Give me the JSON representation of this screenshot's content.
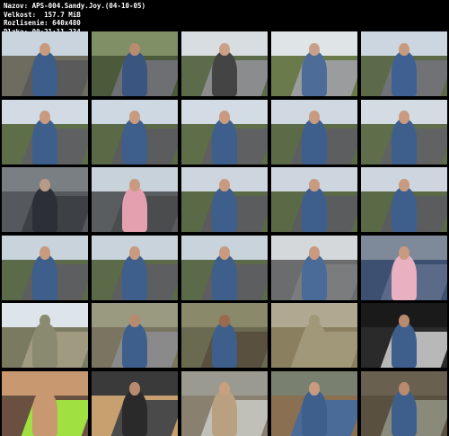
{
  "header": {
    "line1": "Nazov: APS-004.Sandy.Joy.(04-10-05)",
    "line2": "Velkost:  157.7 MiB",
    "line3": "Rozlisenie: 640x480",
    "line4": "Dlzka: 00:21:11.234"
  },
  "thumbnails": [
    {
      "sky": "#c9d4df",
      "ground": "#6e6b5f",
      "road": "#5a5a5a",
      "person": "#3d5d8a",
      "head": "#c89a80"
    },
    {
      "sky": "#7f9067",
      "ground": "#4a5a3a",
      "road": "#6d6f72",
      "person": "#3a5580",
      "head": "#b88a70"
    },
    {
      "sky": "#d8dde2",
      "ground": "#5c6b4a",
      "road": "#8a8c8e",
      "person": "#444",
      "head": "#caa088"
    },
    {
      "sky": "#dfe4e7",
      "ground": "#6a7a4a",
      "road": "#9a9c9e",
      "person": "#4d6c98",
      "head": "#c8a088"
    },
    {
      "sky": "#cbd6e0",
      "ground": "#5c6a4a",
      "road": "#707276",
      "person": "#3e6092",
      "head": "#c89a80"
    },
    {
      "sky": "#d2dbe3",
      "ground": "#5d6e48",
      "road": "#5e6062",
      "person": "#3e5f8c",
      "head": "#c89a80"
    },
    {
      "sky": "#cdd8e3",
      "ground": "#5a6a46",
      "road": "#5a5c5e",
      "person": "#3e5f8c",
      "head": "#c89a80"
    },
    {
      "sky": "#d3dce4",
      "ground": "#5d6e48",
      "road": "#5e6062",
      "person": "#3e5f8c",
      "head": "#c89a80"
    },
    {
      "sky": "#d0d9e2",
      "ground": "#5b6b47",
      "road": "#5c5e60",
      "person": "#3e5f8c",
      "head": "#c89a80"
    },
    {
      "sky": "#d4dce3",
      "ground": "#5e6e4a",
      "road": "#606264",
      "person": "#3e5f8c",
      "head": "#c89a80"
    },
    {
      "sky": "#7a7f84",
      "ground": "#55595d",
      "road": "#3d4145",
      "person": "#2c3036",
      "head": "#b89a88"
    },
    {
      "sky": "#c8d2db",
      "ground": "#5a5d60",
      "road": "#4a4c4e",
      "person": "#e5a0b0",
      "head": "#c89a80"
    },
    {
      "sky": "#cdd6df",
      "ground": "#5a6a46",
      "road": "#5a5c5e",
      "person": "#3e5f8c",
      "head": "#c89a80"
    },
    {
      "sky": "#cdd6df",
      "ground": "#5a6a46",
      "road": "#5a5c5e",
      "person": "#3e5f8c",
      "head": "#c89a80"
    },
    {
      "sky": "#cdd6df",
      "ground": "#5a6a46",
      "road": "#5a5c5e",
      "person": "#3e5f8c",
      "head": "#c89a80"
    },
    {
      "sky": "#c9d3dc",
      "ground": "#5b6a48",
      "road": "#5c5e60",
      "person": "#3e5f8c",
      "head": "#c89a80"
    },
    {
      "sky": "#c9d3dc",
      "ground": "#5b6a48",
      "road": "#5c5e60",
      "person": "#3e5f8c",
      "head": "#c89a80"
    },
    {
      "sky": "#c9d3dc",
      "ground": "#5b6a48",
      "road": "#5c5e60",
      "person": "#3e5f8c",
      "head": "#c89a80"
    },
    {
      "sky": "#d5d8da",
      "ground": "#6a6c6e",
      "road": "#7a7c7e",
      "person": "#4a6a98",
      "head": "#c89a80"
    },
    {
      "sky": "#7e8a9a",
      "ground": "#3d5072",
      "road": "#5a6a88",
      "person": "#e8b0c0",
      "head": "#c89a80"
    },
    {
      "sky": "#dde4ea",
      "ground": "#7a7a60",
      "road": "#a09a80",
      "person": "#8a8a70",
      "head": "#8a8a70"
    },
    {
      "sky": "#9a9a80",
      "ground": "#7a7560",
      "road": "#8a8a8a",
      "person": "#3e5f8c",
      "head": "#b88a70"
    },
    {
      "sky": "#8a8a6a",
      "ground": "#6a6a50",
      "road": "#5a5040",
      "person": "#3e5f8c",
      "head": "#9a6a50"
    },
    {
      "sky": "#b0a890",
      "ground": "#8a8060",
      "road": "#a09878",
      "person": "#a09878",
      "head": "#a09878"
    },
    {
      "sky": "#1a1a1a",
      "ground": "#2a2a2a",
      "road": "#b8b8b8",
      "person": "#3e5f8c",
      "head": "#b88a70"
    },
    {
      "sky": "#c89870",
      "ground": "#6a5040",
      "road": "#a0e040",
      "person": "#c89870",
      "head": "#c89870"
    },
    {
      "sky": "#3a3a3a",
      "ground": "#c8a070",
      "road": "#4a4a4a",
      "person": "#2a2a2a",
      "head": "#b88a70"
    },
    {
      "sky": "#9a9a90",
      "ground": "#8a8070",
      "road": "#c0c0b8",
      "person": "#b8a080",
      "head": "#c8a080"
    },
    {
      "sky": "#7a8070",
      "ground": "#8a7050",
      "road": "#4a6a98",
      "person": "#3e5f8c",
      "head": "#c89a80"
    },
    {
      "sky": "#6a6050",
      "ground": "#5a5040",
      "road": "#8a8a7a",
      "person": "#3e5f8c",
      "head": "#b88a70"
    }
  ]
}
